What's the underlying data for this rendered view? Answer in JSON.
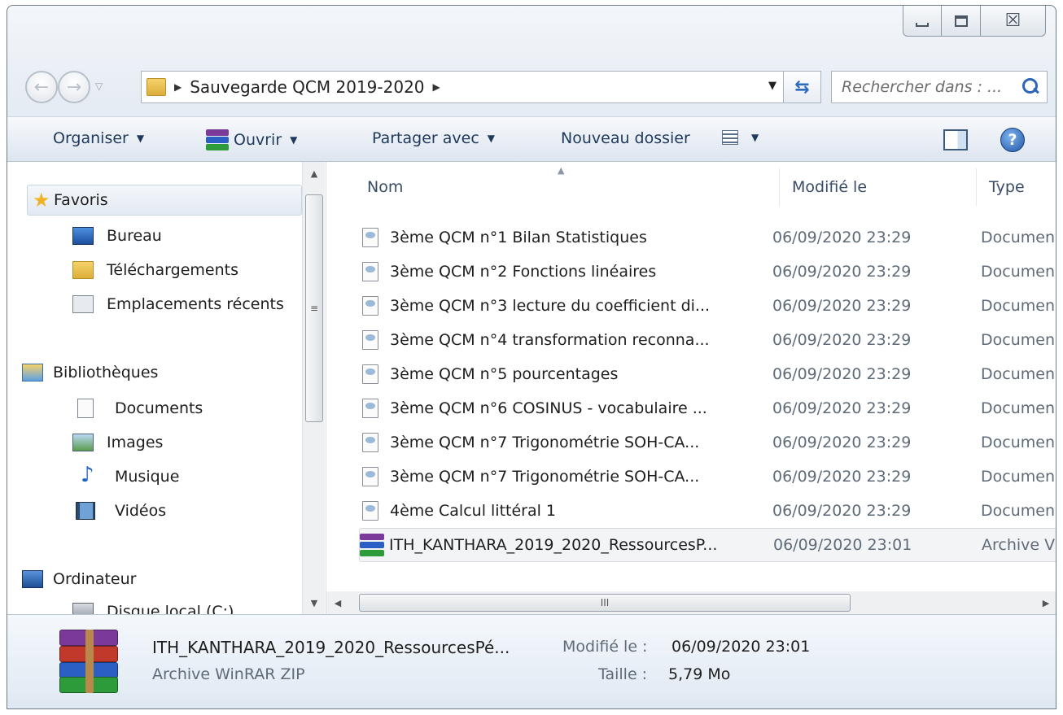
{
  "window": {
    "caption": {
      "minimize_icon": "minimize-icon",
      "maximize_icon": "maximize-icon",
      "close_glyph": "☒"
    }
  },
  "navbar": {
    "breadcrumb": [
      "Sauvegarde QCM 2019-2020"
    ],
    "search_placeholder": "Rechercher dans : ..."
  },
  "toolbar": {
    "organiser": "Organiser",
    "ouvrir": "Ouvrir",
    "partager": "Partager avec",
    "nouveau": "Nouveau dossier"
  },
  "navpane": {
    "favoris": "Favoris",
    "bureau": "Bureau",
    "telechargements": "Téléchargements",
    "recents": "Emplacements récents",
    "bibliotheques": "Bibliothèques",
    "documents": "Documents",
    "images": "Images",
    "musique": "Musique",
    "videos": "Vidéos",
    "ordinateur": "Ordinateur",
    "disque": "Disque local (C:)"
  },
  "columns": {
    "name": "Nom",
    "modified": "Modifié le",
    "type": "Type"
  },
  "files": [
    {
      "name": "3ème QCM n°1  Bilan Statistiques",
      "date": "06/09/2020 23:29",
      "type": "Documen"
    },
    {
      "name": "3ème QCM n°2  Fonctions linéaires",
      "date": "06/09/2020 23:29",
      "type": "Documen"
    },
    {
      "name": "3ème QCM n°3  lecture du coefficient di...",
      "date": "06/09/2020 23:29",
      "type": "Documen"
    },
    {
      "name": "3ème QCM n°4  transformation reconna...",
      "date": "06/09/2020 23:29",
      "type": "Documen"
    },
    {
      "name": "3ème QCM n°5  pourcentages",
      "date": "06/09/2020 23:29",
      "type": "Documen"
    },
    {
      "name": "3ème QCM n°6  COSINUS - vocabulaire ...",
      "date": "06/09/2020 23:29",
      "type": "Documen"
    },
    {
      "name": "3ème QCM n°7  Trigonométrie SOH-CA...",
      "date": "06/09/2020 23:29",
      "type": "Documen"
    },
    {
      "name": "3ème QCM n°7  Trigonométrie SOH-CA...",
      "date": "06/09/2020 23:29",
      "type": "Documen"
    },
    {
      "name": "4ème Calcul littéral 1",
      "date": "06/09/2020 23:29",
      "type": "Documen"
    },
    {
      "name": "ITH_KANTHARA_2019_2020_RessourcesP...",
      "date": "06/09/2020 23:01",
      "type": "Archive V"
    }
  ],
  "scroll": {
    "thumb_glyph": "III",
    "grip_glyph": "≡"
  },
  "details": {
    "name": "ITH_KANTHARA_2019_2020_RessourcesPé...",
    "type": "Archive WinRAR ZIP",
    "modified_label": "Modifié le :",
    "modified_value": "06/09/2020 23:01",
    "size_label": "Taille :",
    "size_value": "5,79 Mo"
  },
  "colors": {
    "toolbar_text": "#1e395b",
    "rar_purple": "#7b3a9a",
    "rar_blue": "#2b5fc4",
    "rar_green": "#2e9b3a",
    "rar_red": "#c0392b"
  }
}
